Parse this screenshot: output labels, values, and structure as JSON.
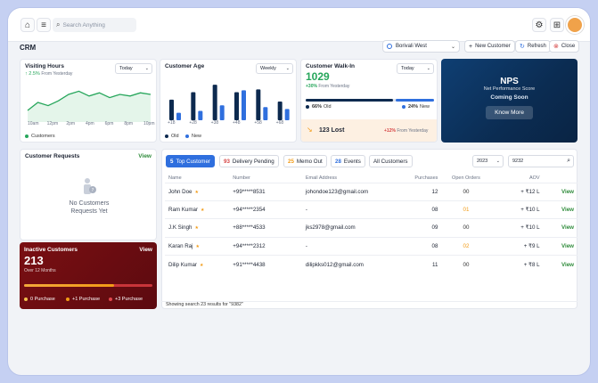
{
  "topbar": {
    "search_placeholder": "Search Anything"
  },
  "page_title": "CRM",
  "toolbar": {
    "location": "Borivali West",
    "new_customer": "New Customer",
    "refresh": "Refresh",
    "close": "Close"
  },
  "visiting_hours": {
    "title": "Visiting Hours",
    "change": "2.5%",
    "change_note": "From Yesterday",
    "period": "Today",
    "x_labels": [
      "10am",
      "12pm",
      "2pm",
      "4pm",
      "6pm",
      "8pm",
      "10pm"
    ],
    "legend": "Customers",
    "series": [
      3,
      4,
      3.6,
      4.2,
      5,
      5.4,
      4.8,
      5.2,
      4.6,
      5.0,
      4.8,
      5.2,
      5.0
    ]
  },
  "customer_age": {
    "title": "Customer Age",
    "period": "Weekly",
    "x_labels": [
      "+18",
      "+28",
      "+38",
      "+48",
      "+58",
      "+68"
    ],
    "old": [
      22,
      30,
      38,
      30,
      33,
      20
    ],
    "new": [
      8,
      10,
      16,
      32,
      14,
      12
    ],
    "legend_old": "Old",
    "legend_new": "New"
  },
  "walk_in": {
    "title": "Customer Walk-In",
    "period": "Today",
    "value": "1029",
    "change": "+30%",
    "change_note": "From Yesterday",
    "old_pct": "66%",
    "old_label": "Old",
    "new_pct": "24%",
    "new_label": "New",
    "lost": "123 Lost",
    "lost_change": "+12%",
    "lost_note": "From Yesterday"
  },
  "nps": {
    "title": "NPS",
    "subtitle": "Net Performance Score",
    "status": "Coming Soon",
    "button": "Know More"
  },
  "requests": {
    "title": "Customer Requests",
    "view": "View",
    "empty_line1": "No Customers",
    "empty_line2": "Requests Yet"
  },
  "inactive": {
    "title": "Inactive Customers",
    "view": "View",
    "value": "213",
    "note": "Over 12 Months",
    "legend": [
      "0 Purchase",
      "+1 Purchase",
      "+3 Purchase"
    ],
    "progress": 0.7
  },
  "tabs": [
    {
      "count": "5",
      "label": "Top Customer"
    },
    {
      "count": "93",
      "label": "Delivery Pending"
    },
    {
      "count": "25",
      "label": "Memo Out"
    },
    {
      "count": "28",
      "label": "Events"
    },
    {
      "count": "",
      "label": "All Customers"
    }
  ],
  "year": "2023",
  "table_search": "9232",
  "table": {
    "headers": [
      "Name",
      "Number",
      "Email Address",
      "Purchases",
      "Open Orders",
      "AOV",
      ""
    ],
    "rows": [
      {
        "name": "John Doe",
        "number": "+99*****8531",
        "email": "johondoe123@gmail.com",
        "purchases": "12",
        "open": "00",
        "aov": "+ ₹12 L",
        "view": "View"
      },
      {
        "name": "Ram Kumar",
        "number": "+94*****2354",
        "email": "-",
        "purchases": "08",
        "open": "01",
        "aov": "+ ₹10 L",
        "view": "View"
      },
      {
        "name": "J.K Singh",
        "number": "+88*****4533",
        "email": "jks2978@gmail.com",
        "purchases": "09",
        "open": "00",
        "aov": "+ ₹10 L",
        "view": "View"
      },
      {
        "name": "Karan Raj",
        "number": "+94*****2312",
        "email": "-",
        "purchases": "08",
        "open": "02",
        "aov": "+ ₹9 L",
        "view": "View"
      },
      {
        "name": "Dilip Kumar",
        "number": "+91*****4438",
        "email": "dilipkks012@gmail.com",
        "purchases": "11",
        "open": "00",
        "aov": "+ ₹8 L",
        "view": "View"
      }
    ]
  },
  "footer": "Showing search 23 results for \"9382\"",
  "colors": {
    "accent": "#2f6fde",
    "navy": "#0d2a4f",
    "green": "#26a65b",
    "orange": "#f29b16",
    "red": "#d64545",
    "maroon": "#6b0d11"
  }
}
